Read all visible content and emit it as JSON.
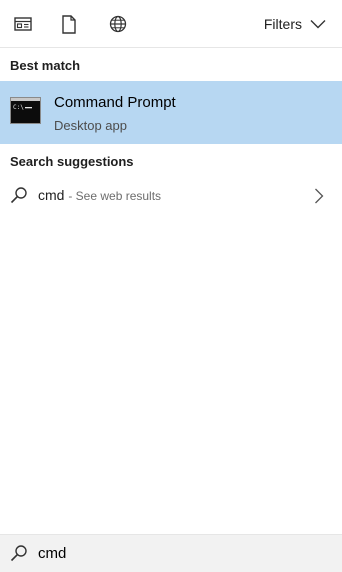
{
  "toolbar": {
    "icons": [
      "apps-icon",
      "documents-icon",
      "web-icon"
    ],
    "filters_label": "Filters"
  },
  "best_match": {
    "header": "Best match",
    "title": "Command Prompt",
    "subtitle": "Desktop app",
    "icon": "command-prompt-icon"
  },
  "suggestions": {
    "header": "Search suggestions",
    "items": [
      {
        "query": "cmd",
        "hint": "- See web results"
      }
    ]
  },
  "search": {
    "value": "cmd"
  },
  "colors": {
    "selection": "#b7d7f2",
    "search_bg": "#f2f2f2"
  }
}
